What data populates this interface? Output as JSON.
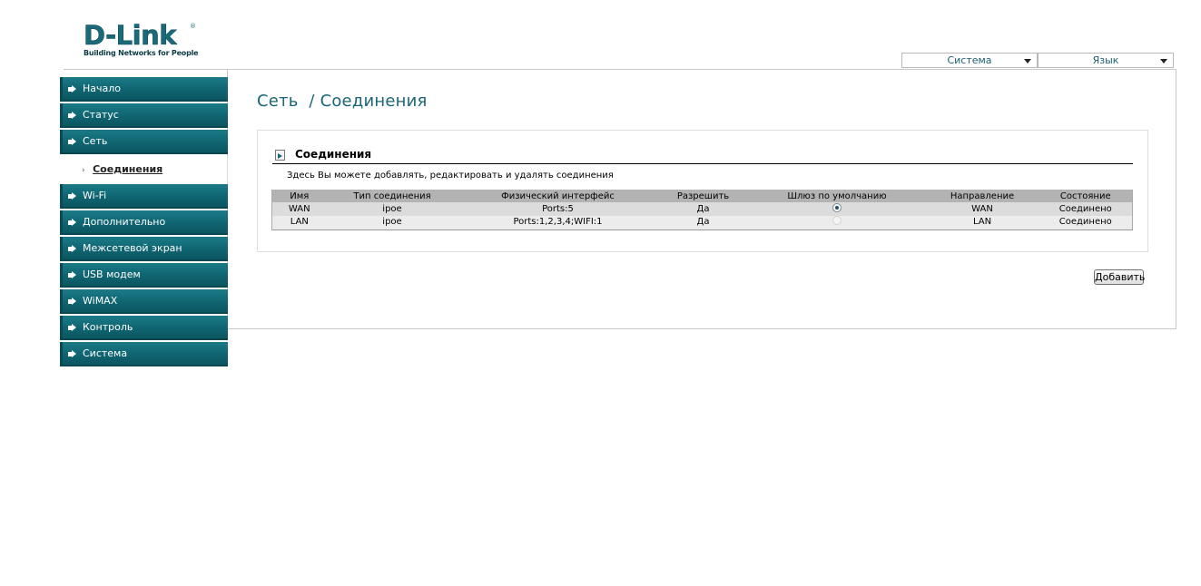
{
  "brand": {
    "logo_text": "D-Link",
    "registered": "®",
    "tagline": "Building Networks for People"
  },
  "top_menu": {
    "system": "Система",
    "language": "Язык"
  },
  "sidebar": {
    "items": [
      {
        "label": "Начало"
      },
      {
        "label": "Статус"
      },
      {
        "label": "Сеть"
      },
      {
        "label": "Wi-Fi"
      },
      {
        "label": "Дополнительно"
      },
      {
        "label": "Межсетевой экран"
      },
      {
        "label": "USB модем"
      },
      {
        "label": "WiMAX"
      },
      {
        "label": "Контроль"
      },
      {
        "label": "Система"
      }
    ],
    "submenu_bullet": "›",
    "submenu_active": "Соединения"
  },
  "page": {
    "title": "Сеть  / Соединения"
  },
  "section": {
    "title": "Соединения",
    "description": "Здесь Вы можете добавлять, редактировать и удалять соединения"
  },
  "table": {
    "headers": [
      "Имя",
      "Тип соединения",
      "Физический интерфейс",
      "Разрешить",
      "Шлюз по умолчанию",
      "Направление",
      "Состояние"
    ],
    "rows": [
      {
        "name": "WAN",
        "type": "ipoe",
        "iface": "Ports:5",
        "enabled": "Да",
        "gateway_selected": true,
        "direction": "WAN",
        "status": "Соединено"
      },
      {
        "name": "LAN",
        "type": "ipoe",
        "iface": "Ports:1,2,3,4;WIFI:1",
        "enabled": "Да",
        "gateway_selected": false,
        "direction": "LAN",
        "status": "Соединено"
      }
    ]
  },
  "actions": {
    "add_label": "Добавить"
  },
  "colors": {
    "menu_teal": "#0f6571",
    "title_teal": "#1a6577",
    "table_header": "#b3b3b3"
  }
}
